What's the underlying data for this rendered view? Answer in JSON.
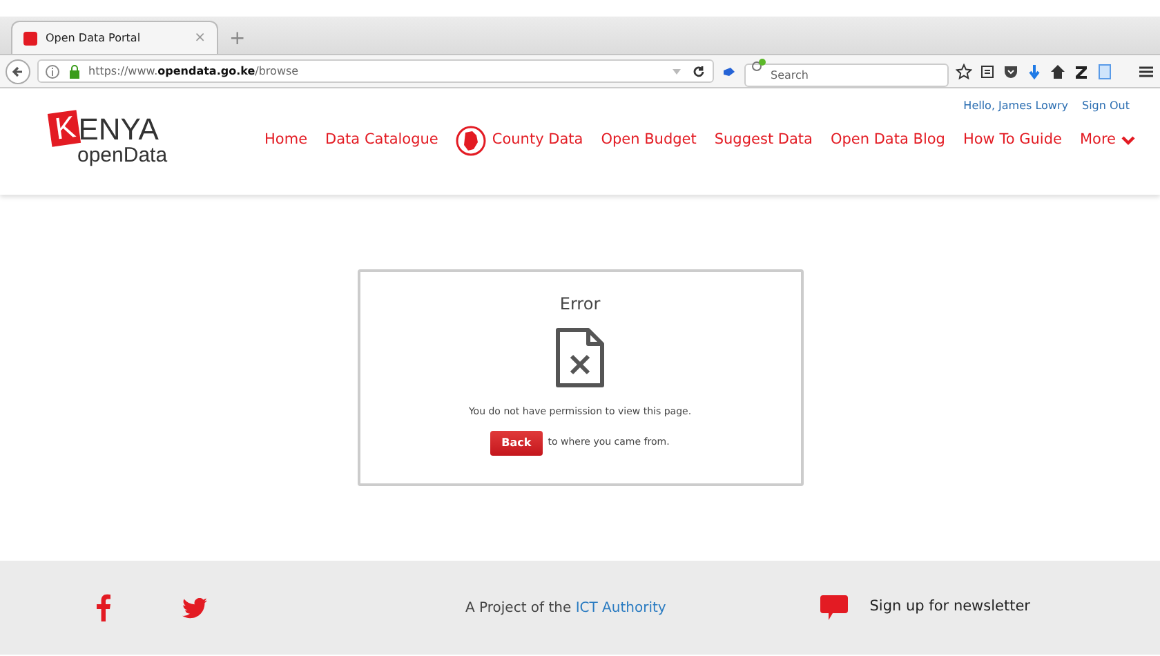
{
  "browser": {
    "tab": {
      "title": "Open Data Portal",
      "close": "×",
      "selected": true
    },
    "new_tab": "+",
    "url": "https://www.**opendata.go.ke**/browse",
    "search": {
      "placeholder": "Search"
    }
  },
  "user_bar": {
    "greeting": "Hello, James Lowry",
    "sign_out": "Sign Out"
  },
  "logo": {
    "initial": "K",
    "rest": "ENYA",
    "sub": "openData"
  },
  "nav": [
    {
      "label": "Home",
      "kind": "link"
    },
    {
      "label": "Data Catalogue",
      "kind": "link"
    },
    {
      "label": "County Data",
      "kind": "county"
    },
    {
      "label": "Open Budget",
      "kind": "link"
    },
    {
      "label": "Suggest Data",
      "kind": "link"
    },
    {
      "label": "Open Data Blog",
      "kind": "link"
    },
    {
      "label": "How To Guide",
      "kind": "link"
    },
    {
      "label": "More",
      "kind": "dropdown"
    }
  ],
  "error": {
    "title": "Error",
    "message": "You do not have permission to view this page.",
    "button": "Back",
    "after": "to where you came from."
  },
  "footer": {
    "project": "A Project of the",
    "link": "ICT Authority",
    "newsletter": "Sign up for newsletter"
  }
}
